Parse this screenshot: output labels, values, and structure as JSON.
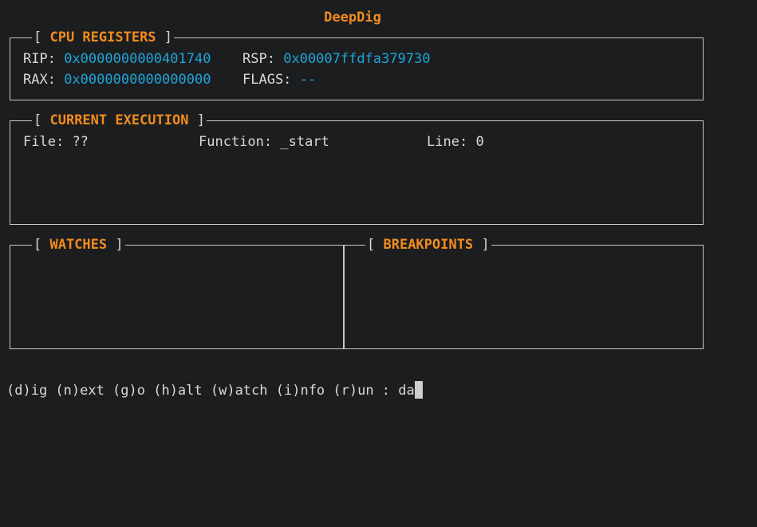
{
  "app": {
    "title": "DeepDig"
  },
  "registers": {
    "title": "CPU REGISTERS",
    "rip_label": "RIP:",
    "rip_value": "0x0000000000401740",
    "rsp_label": "RSP:",
    "rsp_value": "0x00007ffdfa379730",
    "rax_label": "RAX:",
    "rax_value": "0x0000000000000000",
    "flags_label": "FLAGS:",
    "flags_value": "--"
  },
  "execution": {
    "title": "CURRENT EXECUTION",
    "file_label": "File:",
    "file_value": "??",
    "function_label": "Function:",
    "function_value": "_start",
    "line_label": "Line:",
    "line_value": "0"
  },
  "watches": {
    "title": "WATCHES"
  },
  "breakpoints": {
    "title": "BREAKPOINTS"
  },
  "command": {
    "prompt": "(d)ig (n)ext (g)o (h)alt (w)atch (i)nfo (r)un : ",
    "input": "da"
  },
  "colors": {
    "background": "#1c1d1f",
    "accent": "#f28c1e",
    "value": "#1ea5d6",
    "text": "#d9d9d9",
    "border": "#c8c8c8"
  }
}
